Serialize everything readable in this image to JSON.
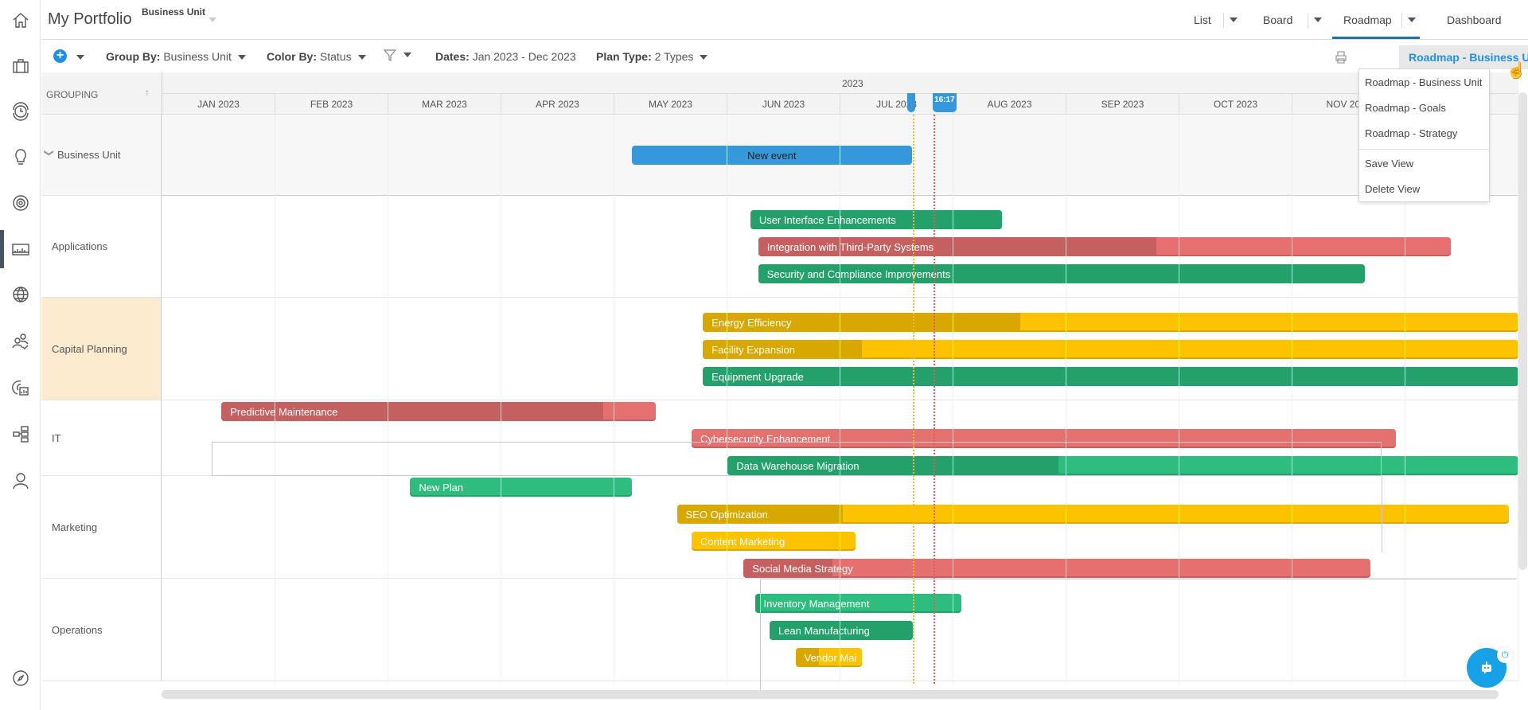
{
  "header": {
    "title": "My Portfolio",
    "context_label": "Business Unit",
    "view_tabs": [
      {
        "label": "List",
        "has_menu": true
      },
      {
        "label": "Board",
        "has_menu": true
      },
      {
        "label": "Roadmap",
        "has_menu": true,
        "active": true
      },
      {
        "label": "Dashboard",
        "has_menu": false
      }
    ]
  },
  "sidebar": {
    "items": [
      {
        "icon": "home-icon"
      },
      {
        "icon": "briefcase-icon"
      },
      {
        "icon": "clock-icon"
      },
      {
        "icon": "lightbulb-icon"
      },
      {
        "icon": "target-icon"
      },
      {
        "icon": "roadmap-chart-icon",
        "active": true
      },
      {
        "icon": "globe-icon"
      },
      {
        "icon": "people-icon"
      },
      {
        "icon": "report-icon"
      },
      {
        "icon": "hierarchy-icon"
      },
      {
        "icon": "user-icon"
      },
      {
        "icon": "compass-icon"
      }
    ]
  },
  "toolbar": {
    "add_label": "+",
    "group_by": {
      "key": "Group By:",
      "value": "Business Unit"
    },
    "color_by": {
      "key": "Color By:",
      "value": "Status"
    },
    "filter_icon": "filter-icon",
    "dates": {
      "key": "Dates:",
      "value": "Jan 2023 - Dec 2023"
    },
    "plan_type": {
      "key": "Plan Type:",
      "value": "2 Types"
    },
    "view_selected": "Roadmap - Business Unit"
  },
  "view_menu": {
    "items": [
      "Roadmap - Business Unit",
      "Roadmap - Goals",
      "Roadmap - Strategy"
    ],
    "actions": [
      "Save View",
      "Delete View"
    ]
  },
  "timeline": {
    "grouping_header": "GROUPING",
    "year": "2023",
    "months": [
      "JAN 2023",
      "FEB 2023",
      "MAR 2023",
      "APR 2023",
      "MAY 2023",
      "JUN 2023",
      "JUL 2023",
      "AUG 2023",
      "SEP 2023",
      "OCT 2023",
      "NOV 2023"
    ],
    "now_label": "16:17",
    "today_month": 6.65,
    "now_month": 6.83
  },
  "colors": {
    "green": "#2ebd7e",
    "green_dark": "#24a06b",
    "red": "#e57070",
    "red_dark": "#c46060",
    "yellow": "#fdc300",
    "yellow_dark": "#d8a800",
    "blue": "#3498db",
    "today_line": "#f5b82e",
    "now_line": "#e8585b",
    "capital_bg": "#fdebd0"
  },
  "groups": [
    {
      "name": "Business Unit",
      "collapsible": true,
      "items": [
        {
          "label": "New event",
          "start": 4.16,
          "end": 6.64,
          "status": "event"
        }
      ]
    },
    {
      "name": "Applications",
      "items": [
        {
          "label": "User Interface Enhancements",
          "start": 5.21,
          "end": 7.44,
          "status": "green",
          "progress_to": 7.44
        },
        {
          "label": "Integration with Third-Party Systems",
          "start": 5.28,
          "end": 11.41,
          "status": "red",
          "progress_to": 8.8
        },
        {
          "label": "Security and Compliance Improvements",
          "start": 5.28,
          "end": 10.65,
          "status": "green",
          "progress_to": 7.44
        }
      ]
    },
    {
      "name": "Capital Planning",
      "highlight": true,
      "items": [
        {
          "label": "Energy Efficiency",
          "start": 4.79,
          "end": 12.5,
          "status": "yellow",
          "progress_to": 7.6
        },
        {
          "label": "Facility Expansion",
          "start": 4.79,
          "end": 12.5,
          "status": "yellow",
          "progress_to": 6.2
        },
        {
          "label": "Equipment Upgrade",
          "start": 4.79,
          "end": 12.5,
          "status": "green",
          "progress_to": 12.5
        }
      ]
    },
    {
      "name": "IT",
      "items": [
        {
          "label": "Predictive Maintenance",
          "start": 0.53,
          "end": 4.37,
          "status": "red",
          "progress_to": 3.91
        },
        {
          "label": "Cybersecurity Enhancement",
          "start": 4.69,
          "end": 10.92,
          "status": "red",
          "progress_to": 4.69
        },
        {
          "label": "Data Warehouse Migration",
          "start": 5.01,
          "end": 12.5,
          "status": "green_light",
          "progress_to": 7.94
        }
      ]
    },
    {
      "name": "Marketing",
      "items": [
        {
          "label": "New Plan",
          "start": 2.2,
          "end": 4.16,
          "status": "green_light",
          "progress_to": 2.2
        },
        {
          "label": "SEO Optimization",
          "start": 4.56,
          "end": 11.92,
          "status": "yellow",
          "progress_to": 6.03
        },
        {
          "label": "Content Marketing",
          "start": 4.69,
          "end": 6.14,
          "status": "yellow",
          "progress_to": 4.69
        },
        {
          "label": "Social Media Strategy",
          "start": 5.15,
          "end": 10.7,
          "status": "red",
          "progress_to": 5.94
        }
      ]
    },
    {
      "name": "Operations",
      "items": [
        {
          "label": "Inventory Management",
          "start": 5.25,
          "end": 7.08,
          "status": "green_light",
          "progress_to": 5.3
        },
        {
          "label": "Lean Manufacturing",
          "start": 5.38,
          "end": 6.65,
          "status": "green",
          "progress_to": 6.65
        },
        {
          "label": "Vendor Mai",
          "start": 5.61,
          "end": 6.2,
          "status": "yellow",
          "progress_to": 5.82
        }
      ]
    }
  ],
  "chatbot": {
    "icon": "chatbot-icon",
    "power_icon": "power-icon"
  }
}
